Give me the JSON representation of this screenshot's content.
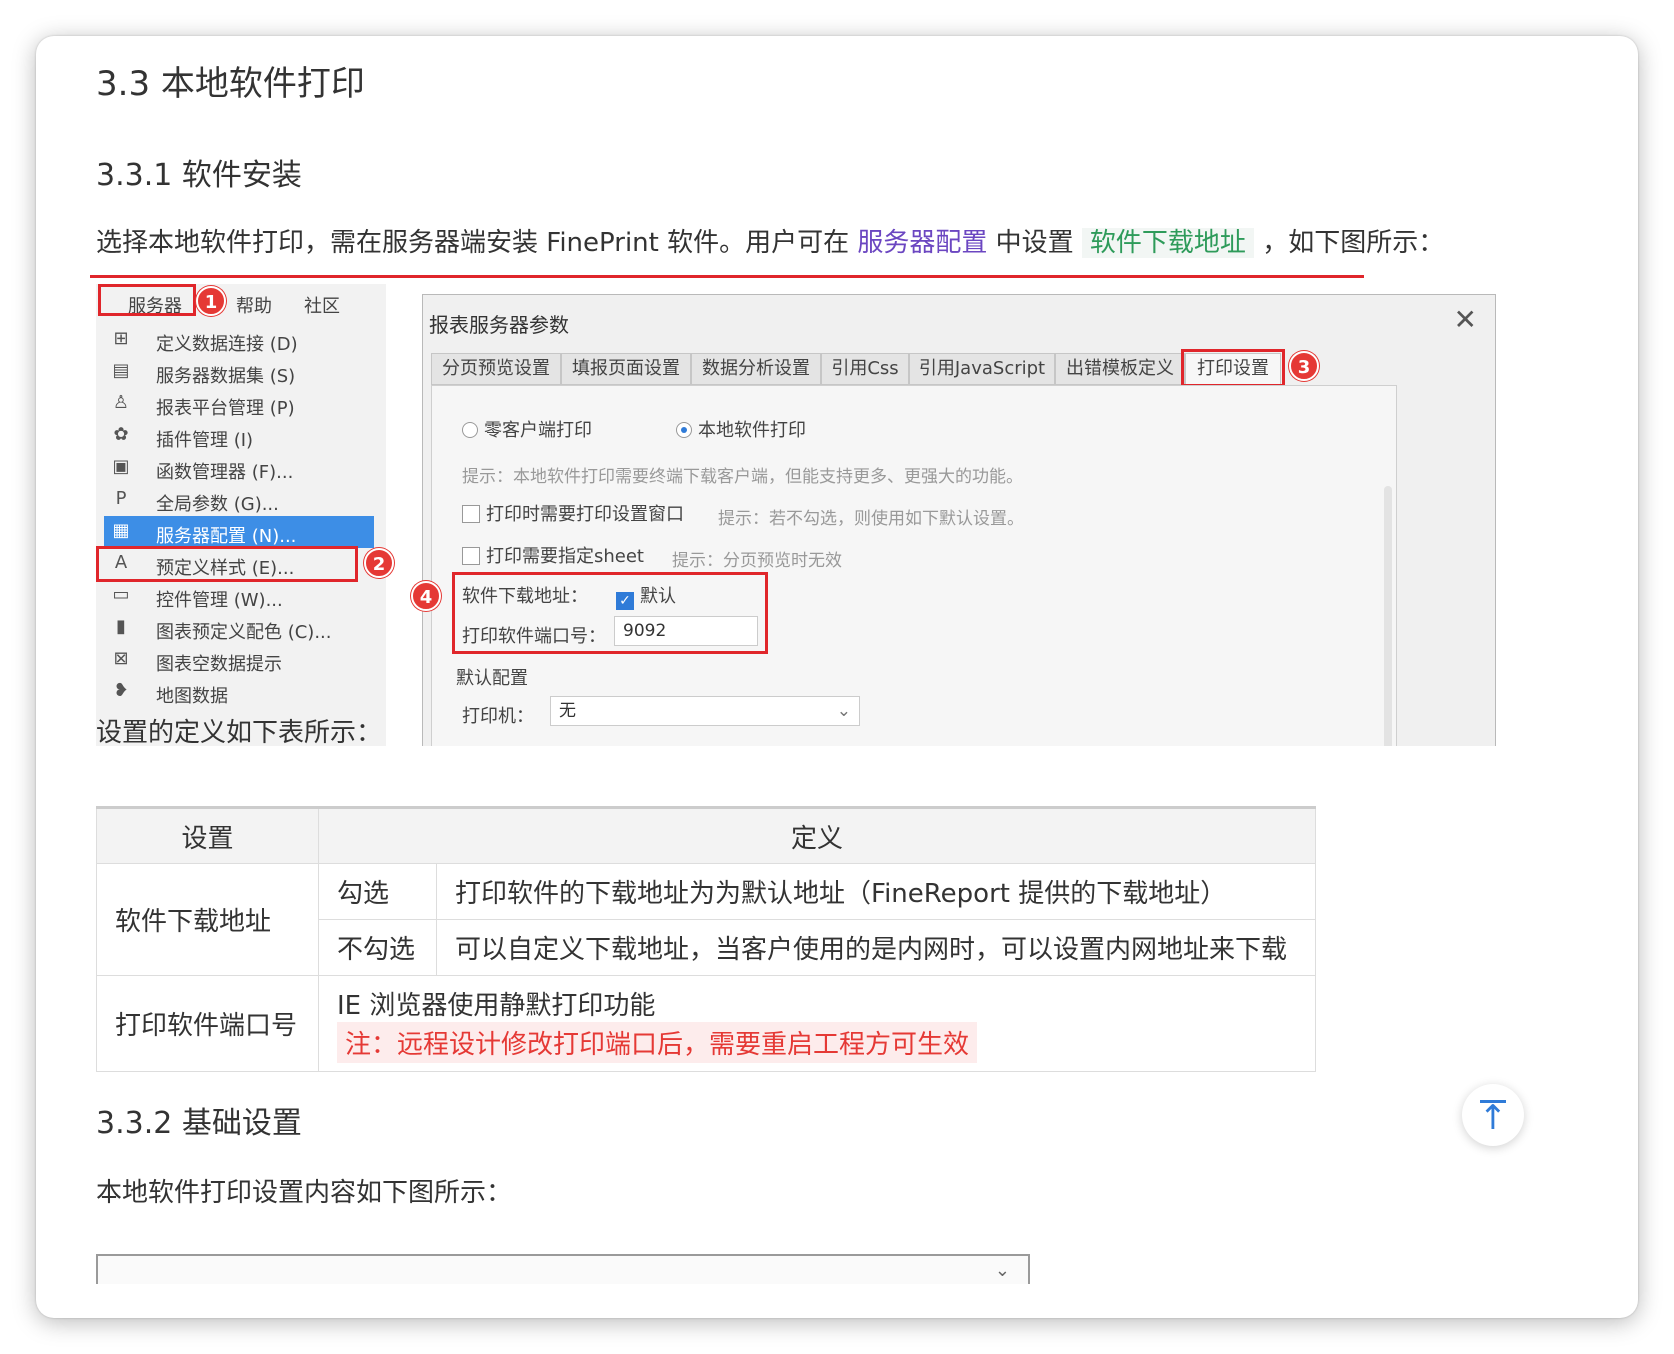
{
  "headings": {
    "h2": "3.3 本地软件打印",
    "h3_install": "3.3.1 软件安装",
    "h3_basic": "3.3.2 基础设置"
  },
  "intro": {
    "prefix": "选择本地软件打印，需在服务器端安装 FinePrint 软件。用户可在 ",
    "link_server_config": "服务器配置",
    "middle": " 中设置 ",
    "link_download_addr": "软件下载地址",
    "suffix": " ，如下图所示："
  },
  "screenshot": {
    "menubar": [
      "服务器",
      "帮助",
      "社区"
    ],
    "menu_items": [
      {
        "icon": "datasource-icon",
        "glyph": "⊞",
        "label": "定义数据连接 (D)"
      },
      {
        "icon": "dataset-icon",
        "glyph": "▤",
        "label": "服务器数据集 (S)"
      },
      {
        "icon": "user-icon",
        "glyph": "♙",
        "label": "报表平台管理 (P)"
      },
      {
        "icon": "plugin-icon",
        "glyph": "✿",
        "label": "插件管理 (I)"
      },
      {
        "icon": "function-icon",
        "glyph": "▣",
        "label": "函数管理器 (F)..."
      },
      {
        "icon": "param-icon",
        "glyph": "P",
        "label": "全局参数 (G)..."
      },
      {
        "icon": "server-config-icon",
        "glyph": "▦",
        "label": "服务器配置 (N)..."
      },
      {
        "icon": "style-icon",
        "glyph": "A",
        "label": "预定义样式 (E)..."
      },
      {
        "icon": "widget-icon",
        "glyph": "▭",
        "label": "控件管理 (W)..."
      },
      {
        "icon": "chart-color-icon",
        "glyph": "▮",
        "label": "图表预定义配色 (C)..."
      },
      {
        "icon": "empty-data-icon",
        "glyph": "⊠",
        "label": "图表空数据提示"
      },
      {
        "icon": "map-icon",
        "glyph": "❥",
        "label": "地图数据"
      }
    ],
    "dialog_title": "报表服务器参数",
    "tabs": [
      "分页预览设置",
      "填报页面设置",
      "数据分析设置",
      "引用Css",
      "引用JavaScript",
      "出错模板定义",
      "打印设置"
    ],
    "radio_zero_client": "零客户端打印",
    "radio_local": "本地软件打印",
    "hint_local": "提示：本地软件打印需要终端下载客户端，但能支持更多、更强大的功能。",
    "chk_print_dialog": "打印时需要打印设置窗口",
    "hint_print_dialog": "提示：若不勾选，则使用如下默认设置。",
    "chk_specify_sheet": "打印需要指定sheet",
    "hint_sheet": "提示：分页预览时无效",
    "download_label": "软件下载地址：",
    "download_default": "默认",
    "port_label": "打印软件端口号：",
    "port_value": "9092",
    "default_config": "默认配置",
    "printer_label": "打印机：",
    "printer_value": "无",
    "badges": [
      "1",
      "2",
      "3",
      "4"
    ]
  },
  "table_intro": "设置的定义如下表所示：",
  "table": {
    "headers": [
      "设置",
      "定义"
    ],
    "row1_setting": "软件下载地址",
    "row1a_option": "勾选",
    "row1a_def": "打印软件的下载地址为为默认地址（FineReport 提供的下载地址）",
    "row1b_option": "不勾选",
    "row1b_def": "可以自定义下载地址，当客户使用的是内网时，可以设置内网地址来下载",
    "row2_setting": "打印软件端口号",
    "row2_def": "IE 浏览器使用静默打印功能",
    "row2_note": "注：远程设计修改打印端口后，需要重启工程方可生效"
  },
  "basic_intro": "本地软件打印设置内容如下图所示：",
  "accent_colors": {
    "red": "#e0262b",
    "blue": "#3d8ee6",
    "purple": "#6b46c1",
    "green": "#2e9b5a"
  }
}
